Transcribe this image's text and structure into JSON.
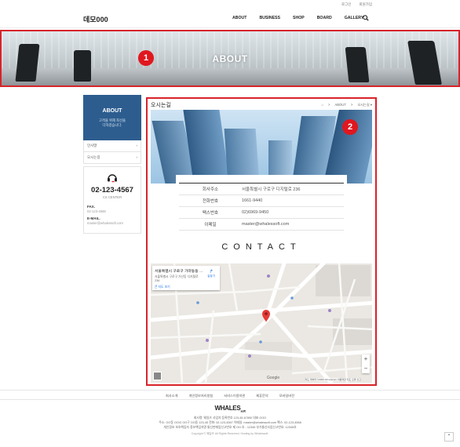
{
  "utility": {
    "login": "로그인",
    "join": "회원가입"
  },
  "header": {
    "logo": "데모000",
    "nav": [
      "ABOUT",
      "BUSINESS",
      "SHOP",
      "BOARD",
      "GALLERY"
    ],
    "search_icon": "search-icon"
  },
  "hero": {
    "title": "ABOUT",
    "badge": "1"
  },
  "sidebar": {
    "title": "ABOUT",
    "subtitle_1": "고객을 위해 최선을",
    "subtitle_2": "다하겠습니다.",
    "items": [
      {
        "label": "인사말",
        "arrow": "›"
      },
      {
        "label": "오시는길",
        "arrow": "›"
      }
    ],
    "phone": "02-123-4567",
    "cs_label": "CS CENTER",
    "fax_label": "FAX.",
    "fax": "02-123-4568",
    "email_label": "E-MAIL.",
    "email": "master@whalessoft.com"
  },
  "content": {
    "page_title": "오시는길",
    "badge": "2",
    "breadcrumb": [
      "⌂",
      ">",
      "ABOUT",
      ">",
      "오시는길 ▾"
    ],
    "info": [
      {
        "key": "회사주소",
        "value": "서울특별시 구로구 디지털로 236"
      },
      {
        "key": "전화번호",
        "value": "1661-9440"
      },
      {
        "key": "팩스번호",
        "value": "02)6969-9450"
      },
      {
        "key": "이메일",
        "value": "master@whalessoft.com"
      }
    ],
    "contact": "CONTACT"
  },
  "map": {
    "card_title": "서울특별시 구로구 가마동동 …",
    "card_address": "서울특별시 구로구 가산동 디지털로 236",
    "card_link": "큰 지도 보기",
    "directions": "길찾기",
    "zoom_in": "+",
    "zoom_out": "−",
    "google": "Google",
    "footer_text": "지도 데이터 ©2020 SK telecom  이용약관  지도 오류 신고"
  },
  "footer": {
    "links": [
      "회사소개",
      "개인정보처리방침",
      "서비스이용약관",
      "제휴문의",
      "모바일버전"
    ],
    "logo": "WHALES",
    "logo_suffix": "soft",
    "info_1": "회사명: 웨일즈 사업자 등록번호 123-45-67890 대표 OOO",
    "info_2": "주소: OO동 OO시 OO구 OO동 123-45 전화: 02-123-4567 이메일: master@whalessoft.com 팩스: 02-123-4568",
    "info_3": "개인정보 보호책임자 정보책임자명 통신판매업신고번호 제 OO 호 - 12345 부가통신사업신고번호: 12345호",
    "copyright": "Copyright © 웨일즈 All Rights Reserved. Hosting by Whalessoft.",
    "to_top": "⌃"
  }
}
